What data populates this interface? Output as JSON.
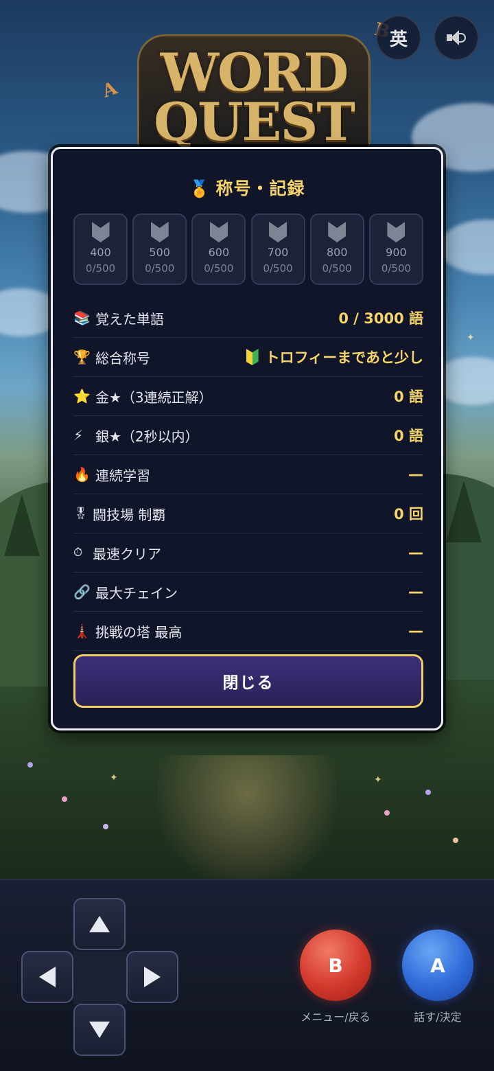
{
  "top_buttons": {
    "language_label": "英",
    "sound_icon": "speaker-icon"
  },
  "logo": {
    "line1": "WORD",
    "line2": "QUEST",
    "deco_a": "A",
    "deco_b": "B"
  },
  "modal": {
    "title_icon": "🏅",
    "title": "称号・記録",
    "badges": [
      {
        "level": "400",
        "progress": "0/500"
      },
      {
        "level": "500",
        "progress": "0/500"
      },
      {
        "level": "600",
        "progress": "0/500"
      },
      {
        "level": "700",
        "progress": "0/500"
      },
      {
        "level": "800",
        "progress": "0/500"
      },
      {
        "level": "900",
        "progress": "0/500"
      }
    ],
    "stats": [
      {
        "icon": "📚",
        "label": "覚えた単語",
        "value": "0 / 3000 語"
      },
      {
        "icon": "🏆",
        "label": "総合称号",
        "value": "トロフィーまであと少し"
      },
      {
        "icon": "⭐",
        "label": "金★（3連続正解）",
        "value": "0 語"
      },
      {
        "icon": "⚡",
        "label": "銀★（2秒以内）",
        "value": "0 語"
      },
      {
        "icon": "🔥",
        "label": "連続学習",
        "value": "—"
      },
      {
        "icon": "🎖",
        "label": "闘技場 制覇",
        "value": "0 回"
      },
      {
        "icon": "⏱",
        "label": "最速クリア",
        "value": "—"
      },
      {
        "icon": "🔗",
        "label": "最大チェイン",
        "value": "—"
      },
      {
        "icon": "🗼",
        "label": "挑戦の塔 最高",
        "value": "—"
      }
    ],
    "close_label": "閉じる"
  },
  "controller": {
    "b_label": "B",
    "b_caption": "メニュー/戻る",
    "a_label": "A",
    "a_caption": "話す/決定"
  },
  "colors": {
    "accent_gold": "#f5d46a",
    "modal_bg": "#111529",
    "button_b": "#d2382c",
    "button_a": "#2e6ad8"
  }
}
